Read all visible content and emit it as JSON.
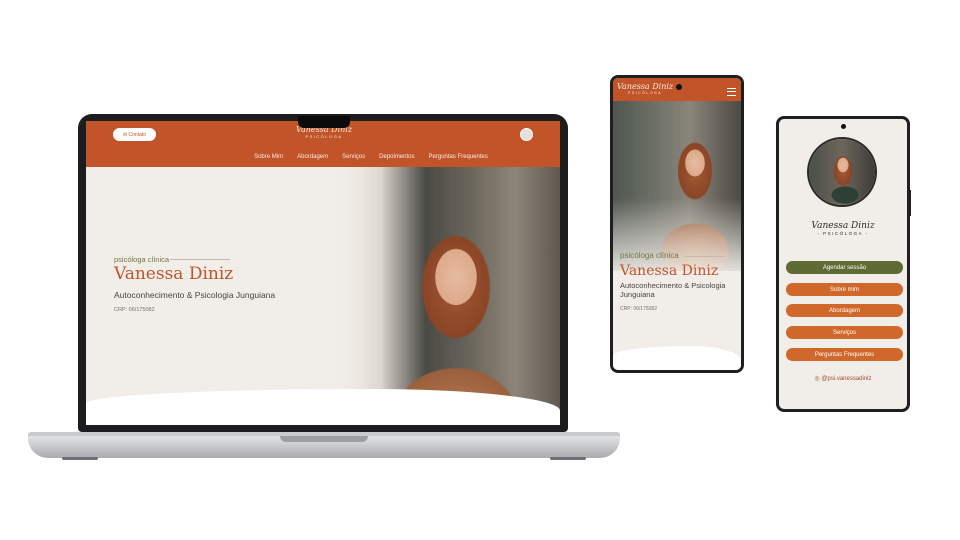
{
  "laptop": {
    "header": {
      "contact_label": "✉ Contato",
      "logo_name": "Vanessa Diniz",
      "logo_sub": "PSICÓLOGA",
      "nav": [
        "Sobre Mim",
        "Abordagem",
        "Serviços",
        "Depoimentos",
        "Perguntas Frequentes"
      ]
    },
    "hero": {
      "kicker": "psicóloga clínica",
      "name": "Vanessa Diniz",
      "subtitle": "Autoconhecimento & Psicologia Junguiana",
      "crp": "CRP: 06/175082"
    }
  },
  "phone_home": {
    "logo_name": "Vanessa Diniz",
    "logo_sub": "PSICÓLOGA",
    "kicker": "psicóloga clínica",
    "name": "Vanessa Diniz",
    "subtitle": "Autoconhecimento & Psicologia Junguiana",
    "crp": "CRP: 06/175082"
  },
  "phone_links": {
    "logo_name": "Vanessa Diniz",
    "logo_sub": "- PSICÓLOGA -",
    "buttons": [
      "Agendar sessão",
      "Sobre mim",
      "Abordagem",
      "Serviços",
      "Perguntas Frequentes"
    ],
    "instagram": "◎ @psi.vanessadiniz"
  },
  "colors": {
    "brand": "#c2542a",
    "accent_green": "#5e6b33",
    "button_orange": "#d0682b",
    "background": "#f1ede8"
  }
}
